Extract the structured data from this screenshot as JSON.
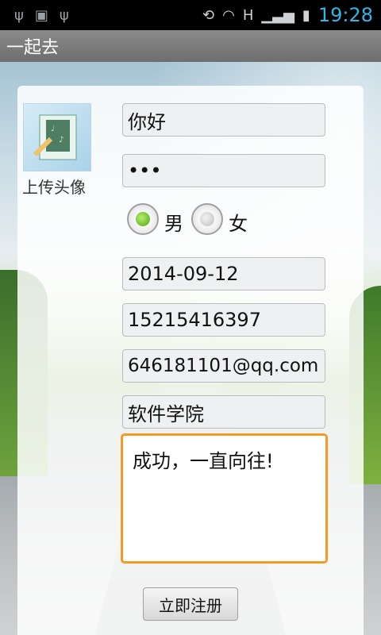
{
  "status_bar": {
    "time": "19:28",
    "left_icons": [
      "usb-icon",
      "android-icon",
      "usb-icon"
    ],
    "right_icons": [
      "rotate-icon",
      "wifi-icon",
      "signal-icon",
      "battery-charging-icon"
    ],
    "network_type": "H"
  },
  "app": {
    "title": "一起去"
  },
  "avatar": {
    "label": "上传头像",
    "icon": "avatar-board-icon"
  },
  "form": {
    "name": "你好",
    "password_masked": "•••",
    "gender": {
      "options": [
        {
          "label": "男",
          "selected": true
        },
        {
          "label": "女",
          "selected": false
        }
      ]
    },
    "birthdate": "2014-09-12",
    "phone": "15215416397",
    "email": "646181101@qq.com",
    "school": "软件学院",
    "motto": "成功，一直向往!"
  },
  "submit_button": {
    "label": "立即注册"
  },
  "colors": {
    "status_time": "#33b5e5",
    "focus_border": "#f59a23",
    "radio_selected": "#4ea21a"
  }
}
